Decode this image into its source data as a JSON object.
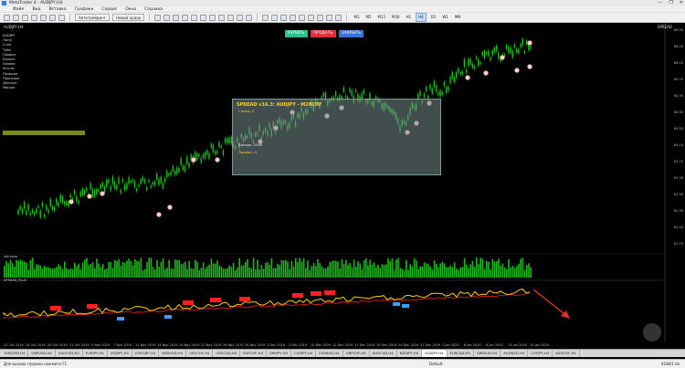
{
  "window": {
    "title": "MetaTrader 4 - AUDJPY,H4",
    "controls": [
      "—",
      "❐",
      "✕"
    ]
  },
  "menu": [
    "Файл",
    "Вид",
    "Вставка",
    "Графики",
    "Сервис",
    "Окно",
    "Справка"
  ],
  "toolbar": {
    "autotrade_label": "Автотрейдинг",
    "new_order_label": "Новый ордер",
    "timeframes": [
      "M1",
      "M5",
      "M15",
      "M30",
      "H1",
      "H4",
      "D1",
      "W1",
      "MN"
    ],
    "active_timeframe": "H4"
  },
  "chart": {
    "symbol_title": "AUDJPY,H4",
    "ea_tag": "SPREAD",
    "buy_label": "КУПИТЬ",
    "sell_label": "ПРОДАТЬ",
    "close_label": "ЗАКРЫТЬ",
    "info_panel": {
      "header": "SPREAD v16.3: AUDJPY - M20CHF",
      "sub": "Спред: 0",
      "red_line": "",
      "blue_line": "",
      "line1": "Баланс: 1000",
      "line2": "Профит: 0"
    },
    "left_panel_rows": [
      "AUDJPY",
      "Лоты",
      "Стоп",
      "Тейк",
      "Профит",
      "Баланс",
      "Уровни",
      "Кол-во",
      "Позиции",
      "Просадка",
      "Депозит",
      "Маржа"
    ],
    "volume_label": "Volumes",
    "indicator_label": "SPREAD_PLUS",
    "price_ticks": [
      "86.90",
      "86.50",
      "86.10",
      "85.70",
      "85.30",
      "84.90",
      "84.50",
      "84.10",
      "83.70",
      "83.30",
      "82.90",
      "82.50",
      "82.10",
      "81.70"
    ],
    "date_ticks": [
      "21 Oct 2019",
      "24 Oct 2019",
      "29 Oct 2019",
      "31 Oct 2019",
      "5 Nov 2019",
      "7 Nov 2019",
      "12 Nov 2019",
      "14 Nov 2019",
      "19 Nov 2019",
      "21 Nov 2019",
      "26 Nov 2019",
      "28 Nov 2019",
      "3 Dec 2019",
      "5 Dec 2019",
      "10 Dec 2019",
      "12 Dec 2019",
      "17 Dec 2019",
      "19 Dec 2019",
      "24 Dec 2019",
      "27 Dec 2019",
      "2 Jan 2020",
      "6 Jan 2020",
      "8 Jan 2020",
      "13 Jan 2020",
      "15 Jan 2020"
    ],
    "colors": {
      "candles": "#22c422",
      "indicator_main": "#ffd000",
      "indicator_signal": "#ff2020",
      "indicator_blue": "#3aa0ff",
      "arrow": "#e03030"
    }
  },
  "tabs": [
    "EURUSD,H4",
    "GBPUSD,H4",
    "AUDUSD,H4",
    "EURJPY,H4",
    "USDJPY,H4",
    "EURGBP,H4",
    "NZDUSD,H4",
    "USDCHF,H4",
    "USDCAD,H4",
    "EURCHF,H4",
    "GBPJPY,H4",
    "CADJPY,H4",
    "EURAUD,H4",
    "GBPCHF,H4",
    "AUDCAD,H4",
    "NZDJPY,H4",
    "AUDJPY,H4",
    "EURCAD,H4",
    "GBPAUD,H4",
    "AUDNZD,H4",
    "CHFJPY,H4",
    "NZDCHF,H4"
  ],
  "active_tab": "AUDJPY,H4",
  "status": {
    "help": "Для вызова справки нажмите F1",
    "profile": "Default",
    "kb": "4248/1 kb"
  }
}
